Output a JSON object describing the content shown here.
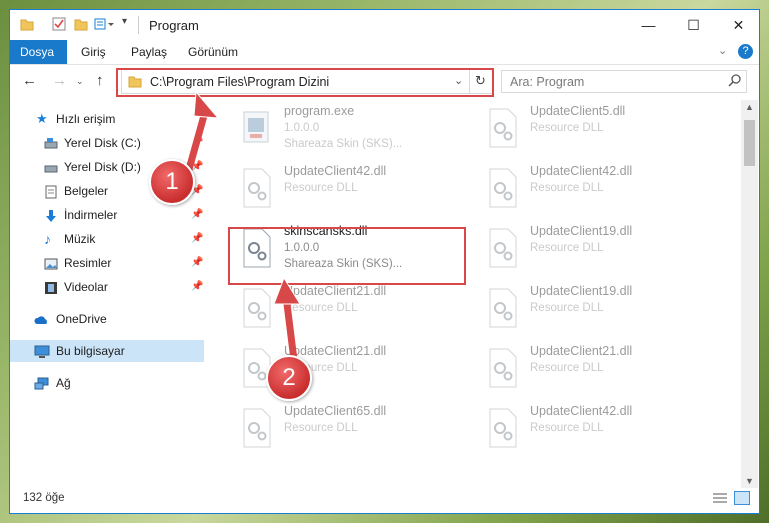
{
  "window": {
    "title": "Program",
    "minimize": "—",
    "maximize": "☐",
    "close": "✕"
  },
  "ribbon": {
    "tabs": [
      "Dosya",
      "Giriş",
      "Paylaş",
      "Görünüm"
    ],
    "active_tab": "Dosya",
    "help": "?"
  },
  "address": {
    "path": "C:\\Program Files\\Program Dizini",
    "search_placeholder": "Ara: Program"
  },
  "sidebar": {
    "items": [
      {
        "label": "Hızlı erişim",
        "icon": "star-icon",
        "pinned": false
      },
      {
        "label": "Yerel Disk (C:)",
        "icon": "drive-icon",
        "pinned": true
      },
      {
        "label": "Yerel Disk (D:)",
        "icon": "drive-icon",
        "pinned": true
      },
      {
        "label": "Belgeler",
        "icon": "documents-icon",
        "pinned": true
      },
      {
        "label": "İndirmeler",
        "icon": "download-icon",
        "pinned": true
      },
      {
        "label": "Müzik",
        "icon": "music-icon",
        "pinned": true
      },
      {
        "label": "Resimler",
        "icon": "pictures-icon",
        "pinned": true
      },
      {
        "label": "Videolar",
        "icon": "video-icon",
        "pinned": true
      },
      {
        "label": "OneDrive",
        "icon": "cloud-icon",
        "pinned": false
      },
      {
        "label": "Bu bilgisayar",
        "icon": "computer-icon",
        "pinned": false
      },
      {
        "label": "Ağ",
        "icon": "network-icon",
        "pinned": false
      }
    ]
  },
  "files": {
    "left": [
      {
        "name": "program.exe",
        "line2": "1.0.0.0",
        "line3": "Shareaza Skin (SKS)..."
      },
      {
        "name": "UpdateClient42.dll",
        "line2": "Resource DLL",
        "line3": ""
      },
      {
        "name": "skinscansks.dll",
        "line2": "1.0.0.0",
        "line3": "Shareaza Skin (SKS)..."
      },
      {
        "name": "UpdateClient21.dll",
        "line2": "Resource DLL",
        "line3": ""
      },
      {
        "name": "UpdateClient21.dll",
        "line2": "Resource DLL",
        "line3": ""
      },
      {
        "name": "UpdateClient65.dll",
        "line2": "Resource DLL",
        "line3": ""
      }
    ],
    "right": [
      {
        "name": "UpdateClient5.dll",
        "line2": "Resource DLL"
      },
      {
        "name": "UpdateClient42.dll",
        "line2": "Resource DLL"
      },
      {
        "name": "UpdateClient19.dll",
        "line2": "Resource DLL"
      },
      {
        "name": "UpdateClient19.dll",
        "line2": "Resource DLL"
      },
      {
        "name": "UpdateClient21.dll",
        "line2": "Resource DLL"
      },
      {
        "name": "UpdateClient42.dll",
        "line2": "Resource DLL"
      }
    ]
  },
  "status": {
    "item_count": "132 öğe"
  },
  "callouts": {
    "badge1": "1",
    "badge2": "2"
  },
  "colors": {
    "accent": "#1979ca",
    "highlight_box": "#d94848",
    "selected_nav": "#cce4f7"
  }
}
